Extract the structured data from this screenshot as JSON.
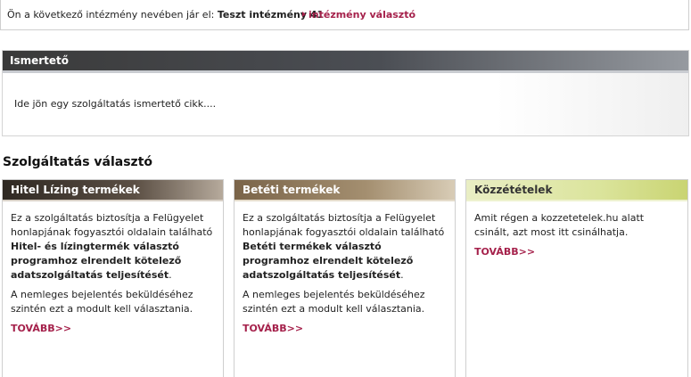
{
  "topbar": {
    "prefix": "Ön a következő intézmény nevében jár el: ",
    "institution": "Teszt intézmény 41",
    "select_link": "intézmény választó"
  },
  "description": {
    "heading": "Ismertető",
    "body": "Ide jön egy szolgáltatás ismertető cikk...."
  },
  "services": {
    "title": "Szolgáltatás választó",
    "cards": [
      {
        "title": "Hitel Lízing termékek",
        "p1_a": "Ez a szolgáltatás biztosítja a Felügyelet honlapjának fogyasztói oldalain található ",
        "p1_b": "Hitel- és lízingtermék választó programhoz elrendelt kötelező adatszolgáltatás teljesítését",
        "p1_c": ".",
        "p2": "A nemleges bejelentés beküldéséhez szintén ezt a modult kell választania.",
        "more": "TOVÁBB>>"
      },
      {
        "title": "Betéti termékek",
        "p1_a": "Ez a szolgáltatás biztosítja a Felügyelet honlapjának fogyasztói oldalain található ",
        "p1_b": "Betéti termékek választó programhoz elrendelt kötelező adatszolgáltatás teljesítését",
        "p1_c": ".",
        "p2": "A nemleges bejelentés beküldéséhez szintén ezt a modult kell választania.",
        "more": "TOVÁBB>>"
      },
      {
        "title": "Közzétételek",
        "p1": "Amit régen a kozzetetelek.hu alatt csinált, azt most itt csinálhatja.",
        "more": "TOVÁBB>>"
      }
    ]
  },
  "colors": {
    "accent": "#a5214b"
  }
}
